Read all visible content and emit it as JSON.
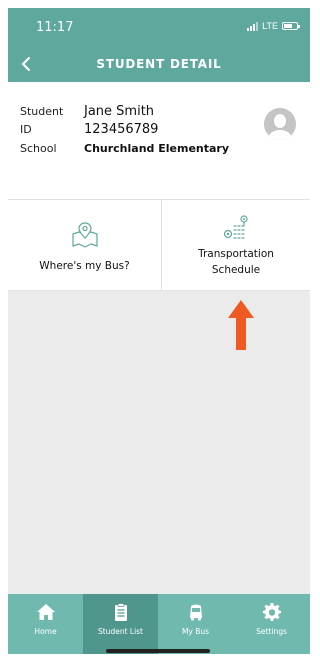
{
  "status_bar": {
    "time": "11:17",
    "network": "LTE"
  },
  "header": {
    "title": "STUDENT DETAIL"
  },
  "student": {
    "fields": [
      {
        "label": "Student",
        "value": "Jane Smith"
      },
      {
        "label": "ID",
        "value": "123456789"
      },
      {
        "label": "School",
        "value": "Churchland Elementary"
      }
    ]
  },
  "actions": {
    "wheres_my_bus": "Where's my Bus?",
    "transportation_schedule": "Transportation Schedule"
  },
  "tabs": [
    {
      "label": "Home",
      "icon": "home-icon",
      "active": false
    },
    {
      "label": "Student List",
      "icon": "clipboard-icon",
      "active": true
    },
    {
      "label": "My Bus",
      "icon": "bus-icon",
      "active": false
    },
    {
      "label": "Settings",
      "icon": "gear-icon",
      "active": false
    }
  ],
  "colors": {
    "primary": "#5ea89e",
    "tabbar": "#6fb9ae",
    "tab_active": "#4f968c",
    "arrow": "#f05a22",
    "background": "#ebebeb"
  }
}
